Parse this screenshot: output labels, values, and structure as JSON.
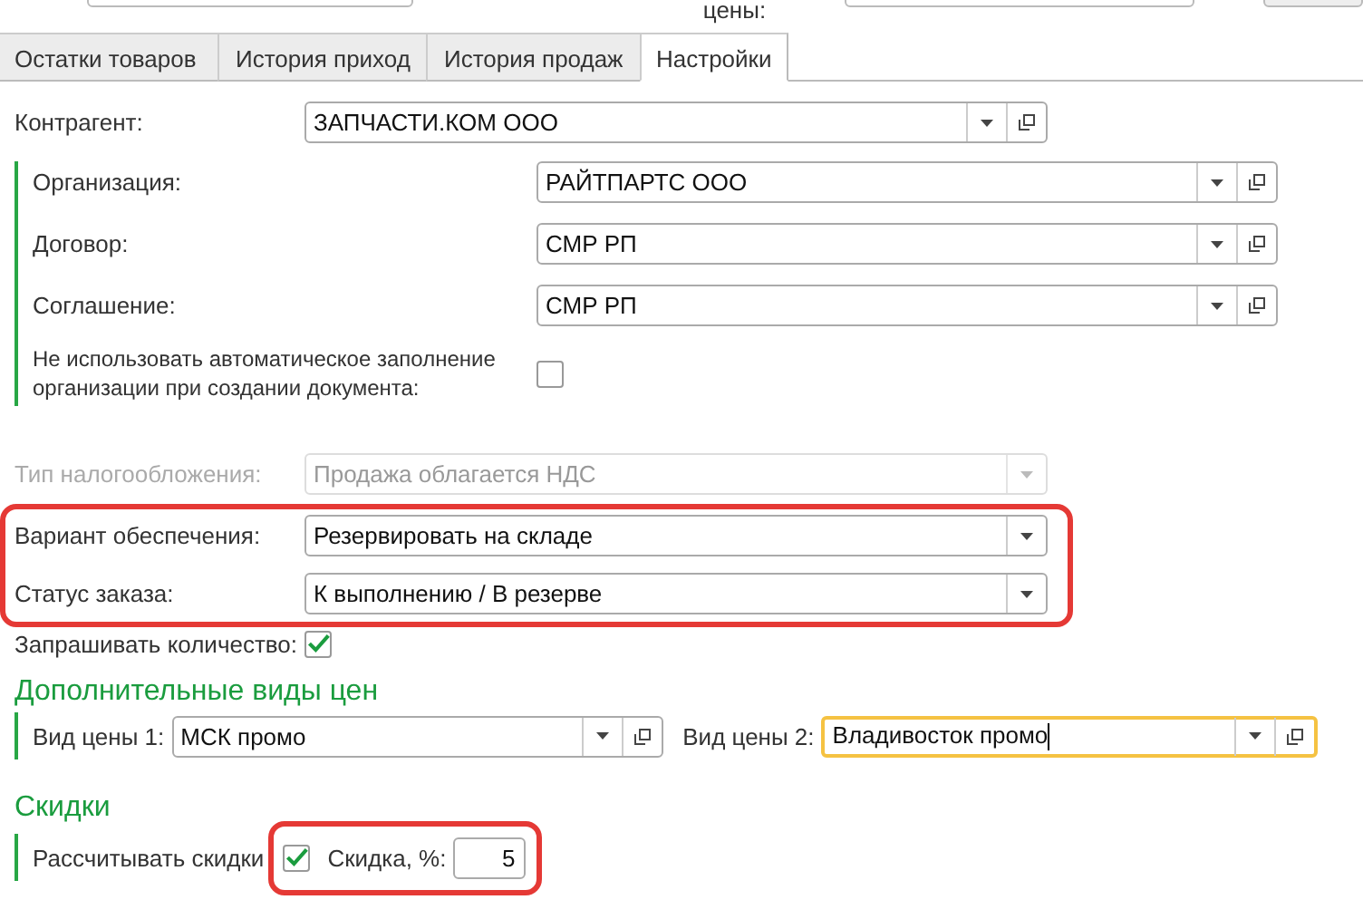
{
  "top_strip": {
    "label": "цены:"
  },
  "tabs": [
    {
      "label": "Остатки товаров",
      "selected": false
    },
    {
      "label": "История приход",
      "selected": false
    },
    {
      "label": "История продаж",
      "selected": false
    },
    {
      "label": "Настройки",
      "selected": true
    }
  ],
  "form": {
    "counterparty": {
      "label": "Контрагент:",
      "value": "ЗАПЧАСТИ.КОМ ООО"
    },
    "org_group": {
      "fields": [
        {
          "label": "Организация:",
          "value": "РАЙТПАРТС ООО"
        },
        {
          "label": "Договор:",
          "value": "СМР РП"
        },
        {
          "label": "Соглашение:",
          "value": "СМР РП"
        }
      ],
      "checkbox": {
        "label": "Не использовать автоматическое заполнение организации при создании документа:",
        "checked": false
      }
    },
    "tax": {
      "label": "Тип налогообложения:",
      "value": "Продажа облагается НДС",
      "disabled": true
    },
    "supply": {
      "highlighted": true,
      "fields": [
        {
          "label": "Вариант обеспечения:",
          "value": "Резервировать на складе"
        },
        {
          "label": "Статус заказа:",
          "value": "К выполнению / В резерве"
        }
      ]
    },
    "ask_quantity": {
      "label": "Запрашивать количество:",
      "checked": true
    }
  },
  "price_types": {
    "title": "Дополнительные виды цен",
    "fields": [
      {
        "label": "Вид цены 1:",
        "value": "МСК промо",
        "focused": false
      },
      {
        "label": "Вид цены 2:",
        "value": "Владивосток промо",
        "focused": true
      }
    ]
  },
  "discounts": {
    "title": "Скидки",
    "calc": {
      "label": "Рассчитывать скидки",
      "checked": true,
      "highlighted": true
    },
    "discount": {
      "label": "Скидка, %:",
      "value": "5"
    }
  }
}
